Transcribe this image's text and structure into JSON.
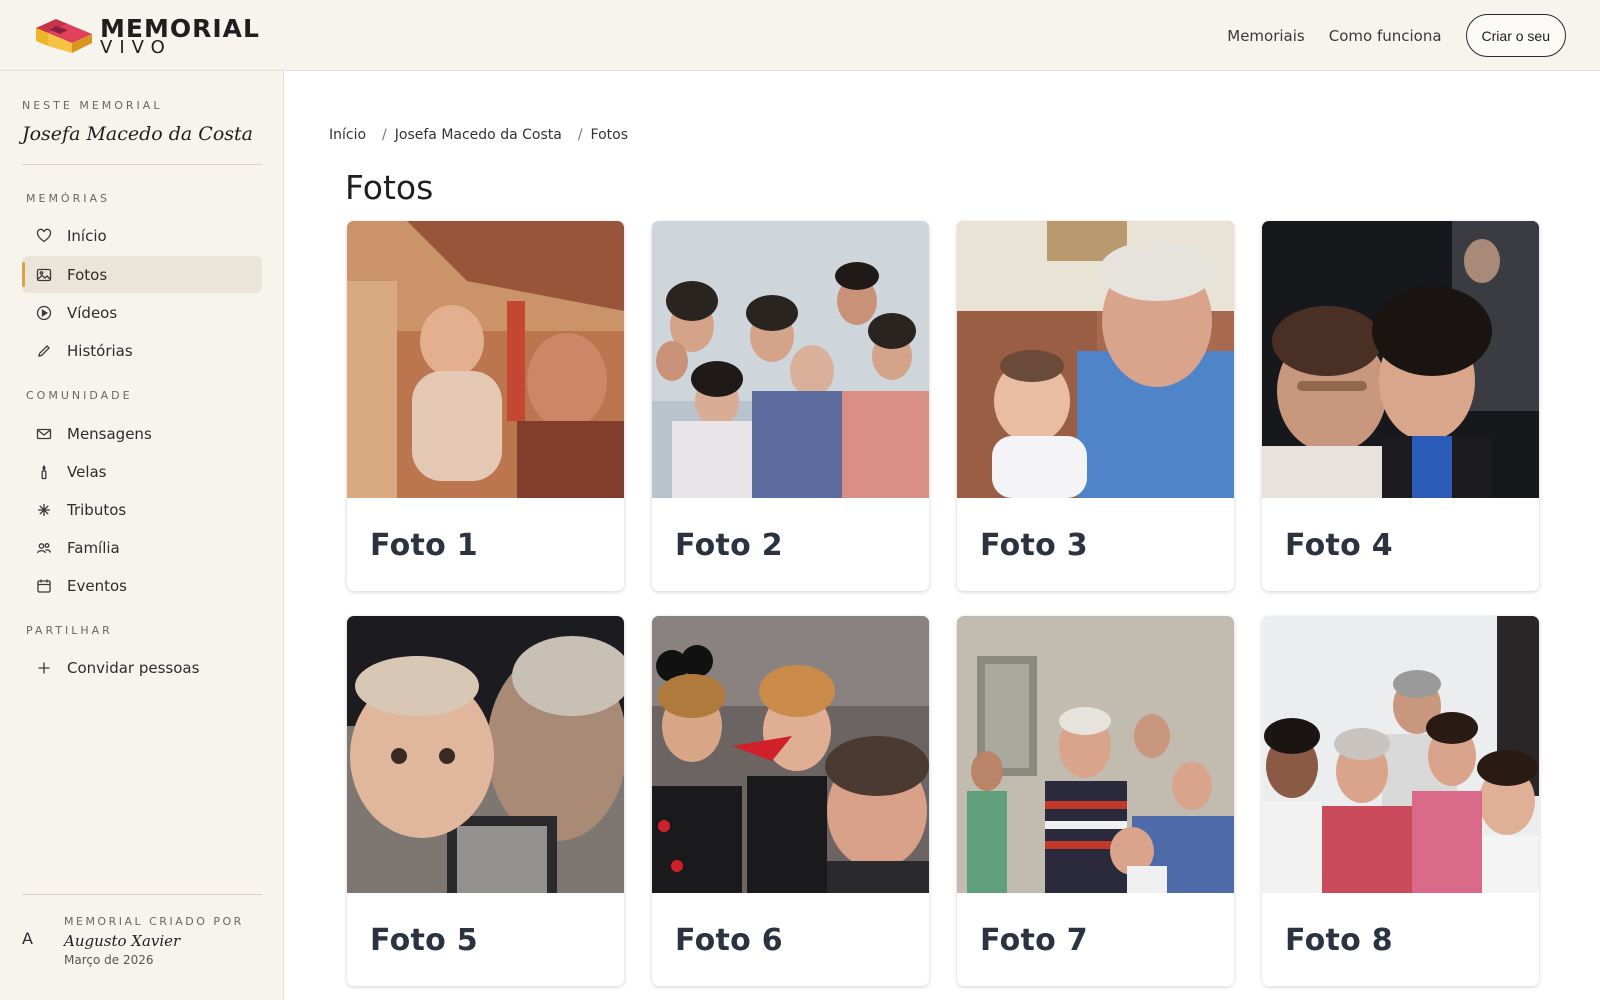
{
  "brand": {
    "line1": "MEMORIAL",
    "line2": "VIVO"
  },
  "nav": {
    "links": [
      "Memoriais",
      "Como funciona"
    ],
    "cta": "Criar o seu"
  },
  "sidebar": {
    "eyebrow": "NESTE MEMORIAL",
    "memorial_name": "Josefa Macedo da Costa",
    "sections": [
      {
        "title": "MEMÓRIAS",
        "items": [
          {
            "label": "Início",
            "icon": "heart-icon"
          },
          {
            "label": "Fotos",
            "icon": "image-icon",
            "active": true
          },
          {
            "label": "Vídeos",
            "icon": "play-icon"
          },
          {
            "label": "Histórias",
            "icon": "pencil-icon"
          }
        ]
      },
      {
        "title": "COMUNIDADE",
        "items": [
          {
            "label": "Mensagens",
            "icon": "mail-icon"
          },
          {
            "label": "Velas",
            "icon": "candle-icon"
          },
          {
            "label": "Tributos",
            "icon": "sparkle-icon"
          },
          {
            "label": "Família",
            "icon": "people-icon"
          },
          {
            "label": "Eventos",
            "icon": "calendar-icon"
          }
        ]
      },
      {
        "title": "PARTILHAR",
        "items": [
          {
            "label": "Convidar pessoas",
            "icon": "plus-icon"
          }
        ]
      }
    ],
    "footer": {
      "avatar_initial": "A",
      "eyebrow": "MEMORIAL CRIADO POR",
      "creator": "Augusto Xavier",
      "date": "Março de 2026"
    }
  },
  "breadcrumb": [
    "Início",
    "Josefa Macedo da Costa",
    "Fotos"
  ],
  "page_title": "Fotos",
  "photos": [
    {
      "caption": "Foto 1"
    },
    {
      "caption": "Foto 2"
    },
    {
      "caption": "Foto 3"
    },
    {
      "caption": "Foto 4"
    },
    {
      "caption": "Foto 5"
    },
    {
      "caption": "Foto 6"
    },
    {
      "caption": "Foto 7"
    },
    {
      "caption": "Foto 8"
    }
  ],
  "colors": {
    "accent": "#d9a441",
    "sidebar_bg": "#f7f4ee",
    "active_bg": "#ebe5d9"
  }
}
